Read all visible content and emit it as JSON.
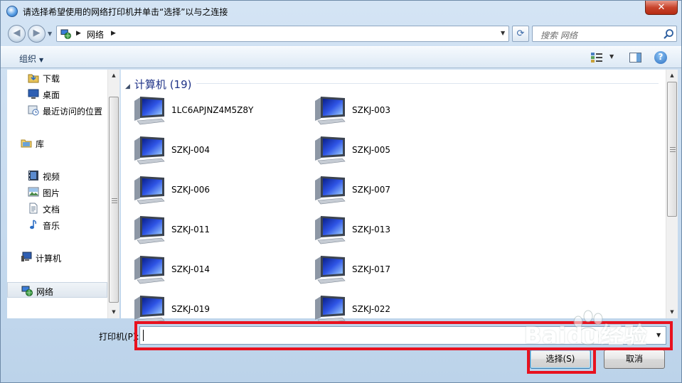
{
  "window": {
    "title": "请选择希望使用的网络打印机并单击“选择”以与之连接",
    "close_label": "✕"
  },
  "navbar": {
    "back": "◀",
    "forward": "▶",
    "address": "网络",
    "search_placeholder": "搜索 网络"
  },
  "toolbar": {
    "organize_label": "组织",
    "help_label": "?"
  },
  "nav_pane": {
    "items": [
      {
        "label": "下载",
        "icon": "download-folder-icon"
      },
      {
        "label": "桌面",
        "icon": "desktop-icon"
      },
      {
        "label": "最近访问的位置",
        "icon": "recent-places-icon"
      },
      {
        "label": "库",
        "icon": "library-icon"
      },
      {
        "label": "视频",
        "icon": "video-icon"
      },
      {
        "label": "图片",
        "icon": "picture-icon"
      },
      {
        "label": "文档",
        "icon": "document-icon"
      },
      {
        "label": "音乐",
        "icon": "music-icon"
      },
      {
        "label": "计算机",
        "icon": "computer-icon"
      },
      {
        "label": "网络",
        "icon": "network-icon",
        "selected": true
      }
    ]
  },
  "content": {
    "group_header": "计算机 (19)",
    "computers": [
      "1LC6APJNZ4M5Z8Y",
      "SZKJ-003",
      "SZKJ-004",
      "SZKJ-005",
      "SZKJ-006",
      "SZKJ-007",
      "SZKJ-011",
      "SZKJ-013",
      "SZKJ-014",
      "SZKJ-017",
      "SZKJ-019",
      "SZKJ-022"
    ]
  },
  "bottom": {
    "printer_label": "打印机(P):",
    "printer_value": "",
    "select_button": "选择(S)",
    "cancel_button": "取消"
  },
  "watermark": {
    "text": "Baidu经验"
  },
  "colors": {
    "highlight_box": "#e8121f",
    "group_header": "#1e3287"
  }
}
